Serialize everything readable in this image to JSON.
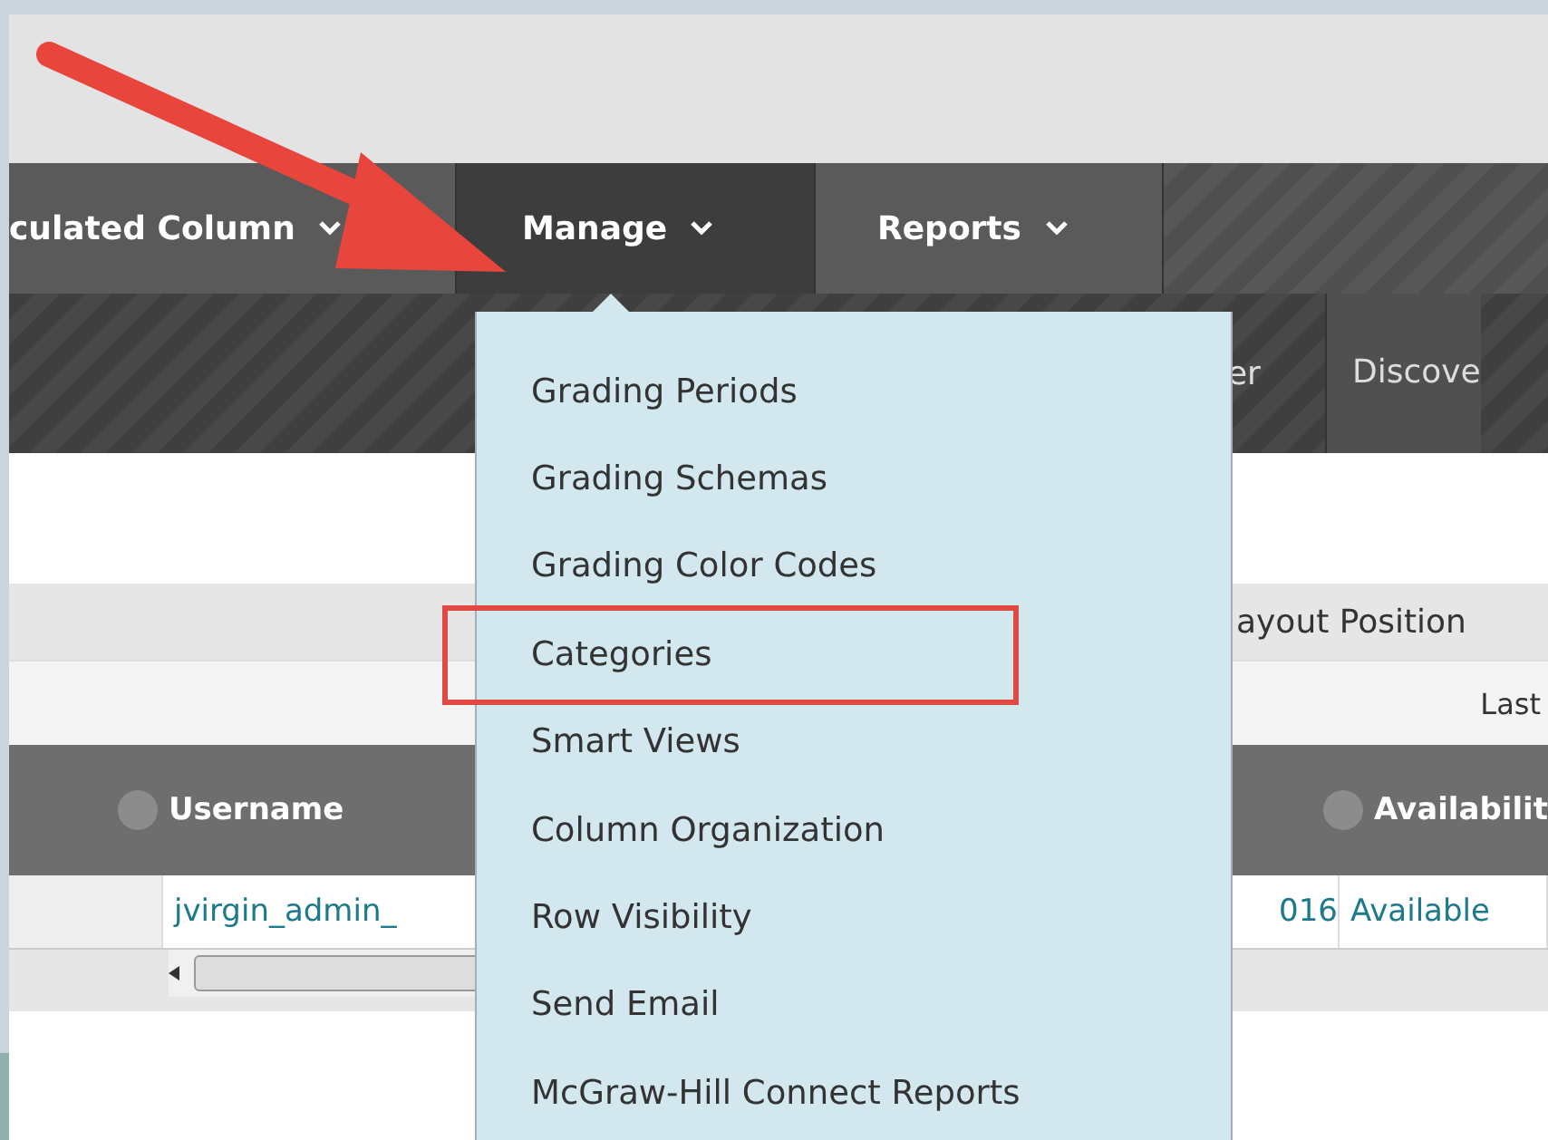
{
  "nav_tabs": [
    {
      "label": "culated Column",
      "selected": false
    },
    {
      "label": "Manage",
      "selected": true
    },
    {
      "label": "Reports",
      "selected": false
    }
  ],
  "sub_bar": [
    "er",
    "Discove"
  ],
  "toolbar": {
    "layout_position": "ayout Position",
    "last": "Last"
  },
  "table": {
    "columns": [
      "",
      "Username",
      "",
      "Availabilit"
    ],
    "rows": [
      [
        "",
        "jvirgin_admin_",
        "016",
        "Available"
      ]
    ]
  },
  "dropdown": [
    {
      "label": "Grading Periods",
      "highlighted": false
    },
    {
      "label": "Grading Schemas",
      "highlighted": false
    },
    {
      "label": "Grading Color Codes",
      "highlighted": false
    },
    {
      "label": "Categories",
      "highlighted": true
    },
    {
      "label": "Smart Views",
      "highlighted": false
    },
    {
      "label": "Column Organization",
      "highlighted": false
    },
    {
      "label": "Row Visibility",
      "highlighted": false
    },
    {
      "label": "Send Email",
      "highlighted": false
    },
    {
      "label": "McGraw-Hill Connect Reports",
      "highlighted": false
    }
  ]
}
